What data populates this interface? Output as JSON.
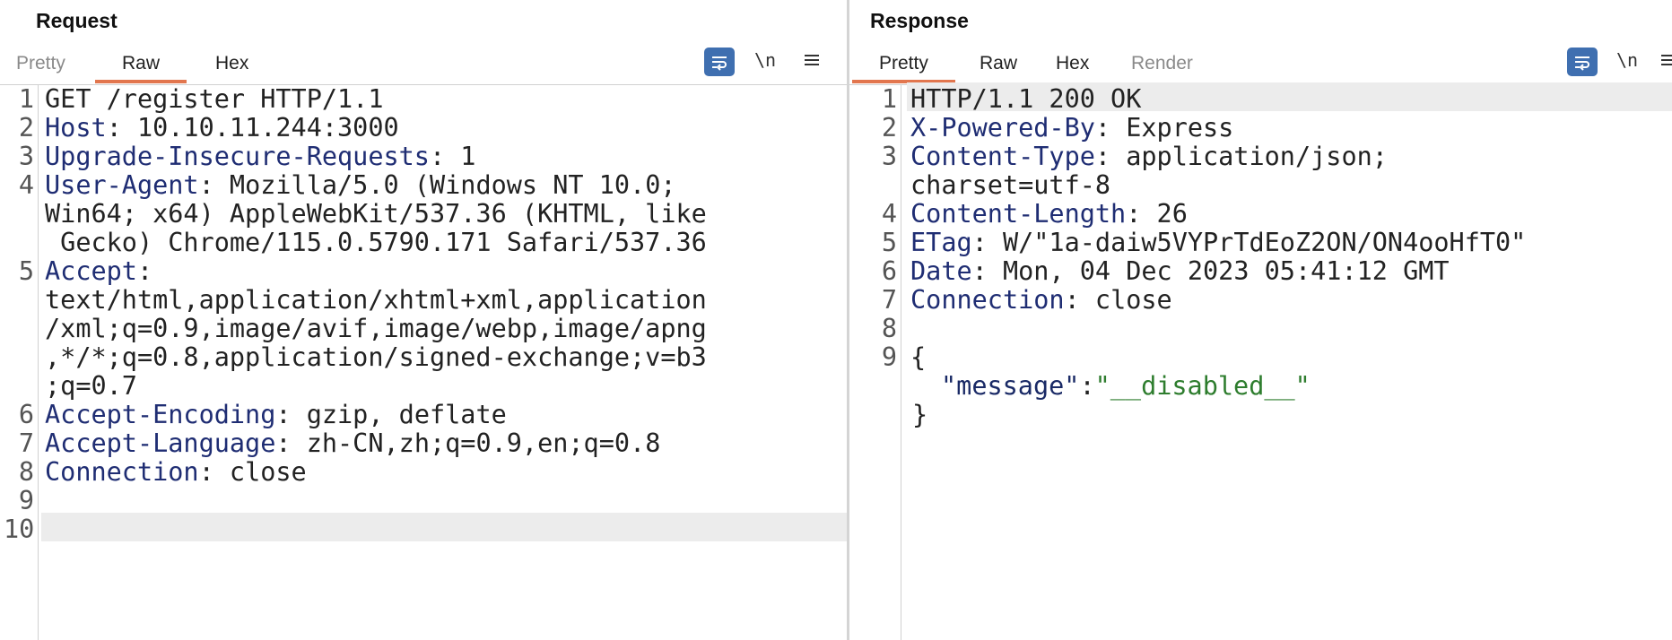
{
  "request": {
    "title": "Request",
    "tabs": [
      {
        "label": "Pretty",
        "active": false
      },
      {
        "label": "Raw",
        "active": true
      },
      {
        "label": "Hex",
        "active": false
      }
    ],
    "tools": {
      "wrap_icon": "wrap-lines-icon",
      "newline_label": "\\n",
      "menu_icon": "hamburger-menu-icon"
    },
    "lines": [
      {
        "num": "1",
        "rows": [
          "GET /register HTTP/1.1"
        ],
        "header": null
      },
      {
        "num": "2",
        "header": "Host",
        "rows": [
          ": 10.10.11.244:3000"
        ]
      },
      {
        "num": "3",
        "header": "Upgrade-Insecure-Requests",
        "rows": [
          ": 1"
        ]
      },
      {
        "num": "4",
        "header": "User-Agent",
        "rows": [
          ": Mozilla/5.0 (Windows NT 10.0;",
          "Win64; x64) AppleWebKit/537.36 (KHTML, like",
          " Gecko) Chrome/115.0.5790.171 Safari/537.36"
        ]
      },
      {
        "num": "5",
        "header": "Accept",
        "rows": [
          ":",
          "text/html,application/xhtml+xml,application",
          "/xml;q=0.9,image/avif,image/webp,image/apng",
          ",*/*;q=0.8,application/signed-exchange;v=b3",
          ";q=0.7"
        ]
      },
      {
        "num": "6",
        "header": "Accept-Encoding",
        "rows": [
          ": gzip, deflate"
        ]
      },
      {
        "num": "7",
        "header": "Accept-Language",
        "rows": [
          ": zh-CN,zh;q=0.9,en;q=0.8"
        ]
      },
      {
        "num": "8",
        "header": "Connection",
        "rows": [
          ": close"
        ]
      },
      {
        "num": "9",
        "header": null,
        "rows": [
          ""
        ]
      },
      {
        "num": "10",
        "header": null,
        "rows": [
          ""
        ]
      }
    ]
  },
  "response": {
    "title": "Response",
    "tabs": [
      {
        "label": "Pretty",
        "active": true
      },
      {
        "label": "Raw",
        "active": false
      },
      {
        "label": "Hex",
        "active": false
      },
      {
        "label": "Render",
        "active": false,
        "muted": true
      }
    ],
    "tools": {
      "wrap_icon": "wrap-lines-icon",
      "newline_label": "\\n",
      "menu_icon": "hamburger-menu-icon"
    },
    "lines": [
      {
        "num": "1",
        "header": null,
        "rows": [
          "HTTP/1.1 200 OK"
        ]
      },
      {
        "num": "2",
        "header": "X-Powered-By",
        "rows": [
          ": Express"
        ]
      },
      {
        "num": "3",
        "header": "Content-Type",
        "rows": [
          ": application/json;",
          "charset=utf-8"
        ]
      },
      {
        "num": "4",
        "header": "Content-Length",
        "rows": [
          ": 26"
        ]
      },
      {
        "num": "5",
        "header": "ETag",
        "rows": [
          ": W/\"1a-daiw5VYPrTdEoZ2ON/ON4ooHfT0\""
        ]
      },
      {
        "num": "6",
        "header": "Date",
        "rows": [
          ": Mon, 04 Dec 2023 05:41:12 GMT"
        ]
      },
      {
        "num": "7",
        "header": "Connection",
        "rows": [
          ": close"
        ]
      },
      {
        "num": "8",
        "header": null,
        "rows": [
          ""
        ]
      },
      {
        "num": "9",
        "header": null,
        "rows": [
          "{"
        ]
      }
    ],
    "json_body": {
      "key": "\"message\"",
      "colon": ":",
      "value": "\"__disabled__\"",
      "close": "}"
    }
  },
  "colors": {
    "accent_tab": "#e2764e",
    "header_key": "#1f2d73",
    "json_string": "#2e7d2e",
    "wrap_button": "#3f6fb0"
  }
}
